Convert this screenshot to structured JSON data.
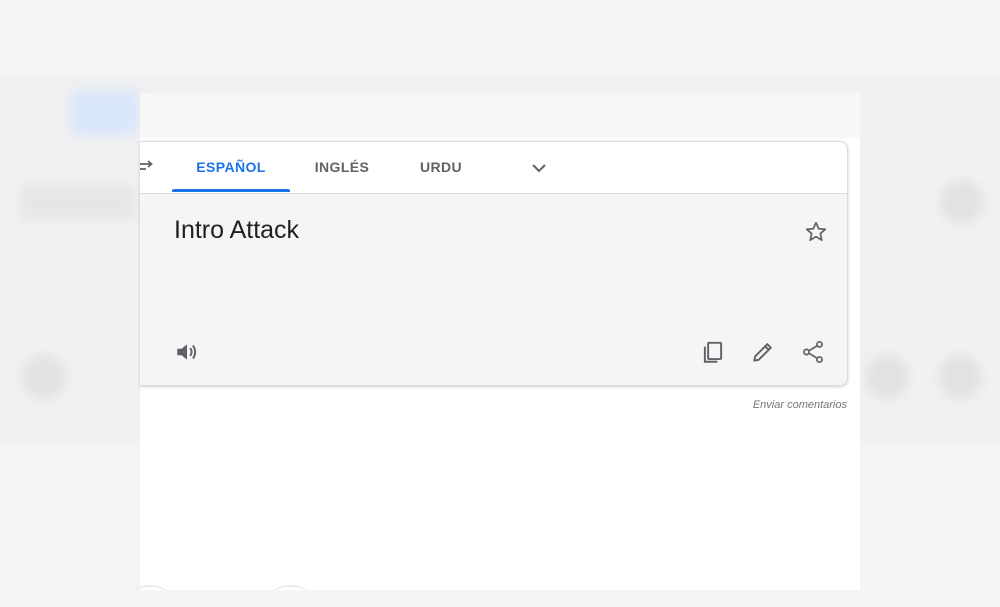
{
  "tabs": [
    {
      "label": "ESPAÑOL",
      "active": true
    },
    {
      "label": "INGLÉS",
      "active": false
    },
    {
      "label": "URDU",
      "active": false
    }
  ],
  "translation": {
    "text": "Intro Attack"
  },
  "icons": {
    "swap": "swap-languages-icon",
    "more_languages": "chevron-down-icon",
    "save": "star-outline-icon",
    "listen": "speaker-icon",
    "copy": "copy-icon",
    "edit": "pencil-icon",
    "share": "share-icon"
  },
  "footer": {
    "feedback_label": "Enviar comentarios"
  },
  "colors": {
    "accent": "#1a73e8",
    "icon": "#5f6368",
    "text": "#202124"
  }
}
